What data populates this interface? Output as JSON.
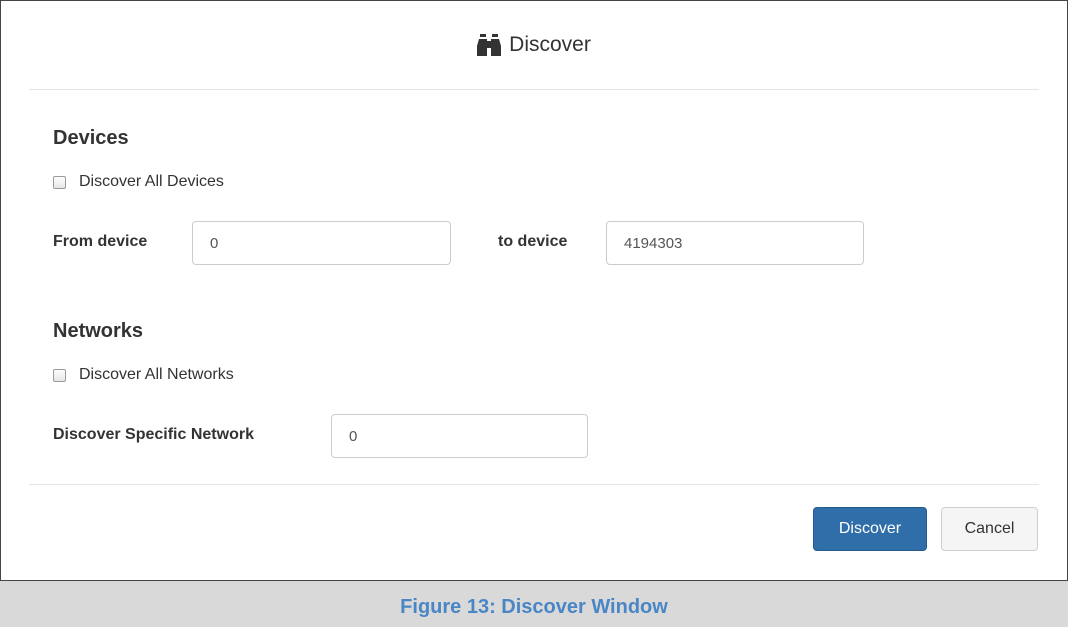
{
  "dialog": {
    "title": "Discover",
    "title_icon": "binoculars-icon"
  },
  "devices": {
    "heading": "Devices",
    "discover_all_label": "Discover All Devices",
    "discover_all_checked": false,
    "from_label": "From device",
    "from_value": "0",
    "to_label": "to device",
    "to_value": "4194303"
  },
  "networks": {
    "heading": "Networks",
    "discover_all_label": "Discover All Networks",
    "discover_all_checked": false,
    "specific_label": "Discover Specific Network",
    "specific_value": "0"
  },
  "footer": {
    "discover_label": "Discover",
    "cancel_label": "Cancel"
  },
  "caption": "Figure 13: Discover Window",
  "colors": {
    "primary": "#2f6ea8",
    "caption_text": "#4a86c5",
    "caption_bg": "#d9d9d9"
  }
}
